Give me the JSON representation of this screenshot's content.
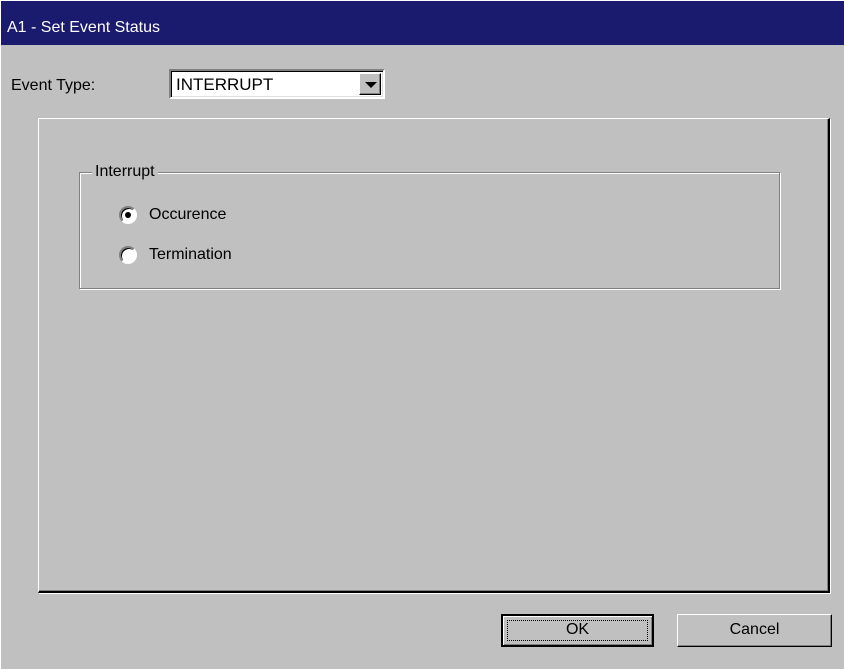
{
  "window": {
    "title": "A1 - Set Event Status"
  },
  "event_type": {
    "label": "Event Type:",
    "selected": "INTERRUPT",
    "dropdown_icon": "chevron-down-icon"
  },
  "interrupt_group": {
    "legend": "Interrupt",
    "options": [
      {
        "label": "Occurence",
        "checked": true
      },
      {
        "label": "Termination",
        "checked": false
      }
    ]
  },
  "buttons": {
    "ok": "OK",
    "cancel": "Cancel"
  }
}
